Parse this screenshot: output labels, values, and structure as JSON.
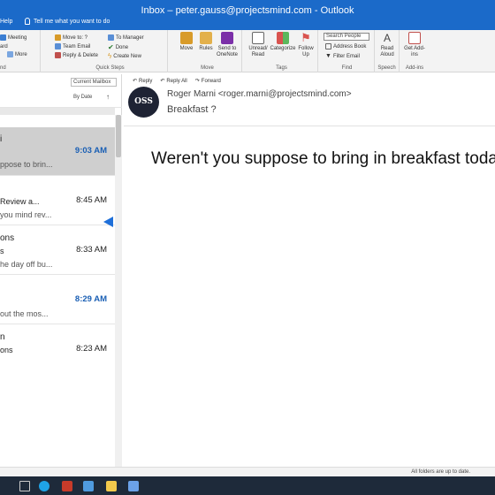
{
  "window": {
    "title": "Inbox – peter.gauss@projectsmind.com - Outlook",
    "help": "Help",
    "tell_me": "Tell me what you want to do"
  },
  "ribbon": {
    "new_group_label": "nd",
    "respond": {
      "meeting": "Meeting",
      "forward_partial": "ard",
      "more": "More"
    },
    "quick_steps": {
      "label": "Quick Steps",
      "items": [
        "Move to: ?",
        "To Manager",
        "Team Email",
        "Done",
        "Reply & Delete",
        "Create New"
      ]
    },
    "move": {
      "label": "Move",
      "move": "Move",
      "rules": "Rules",
      "onenote": "Send to OneNote"
    },
    "tags": {
      "label": "Tags",
      "unread_read": "Unread/ Read",
      "categorize": "Categorize",
      "follow_up": "Follow Up"
    },
    "find": {
      "label": "Find",
      "search_people": "Search People",
      "address_book": "Address Book",
      "filter_email": "Filter Email"
    },
    "speech": {
      "label": "Speech",
      "read_aloud": "Read Aloud"
    },
    "addins": {
      "label": "Add-ins",
      "get_addins": "Get Add-ins"
    },
    "colors": {
      "titlebar": "#1b6ac9",
      "accent": "#1a5fb4"
    }
  },
  "message_list": {
    "mailbox": "Current Mailbox",
    "sort": "By Date",
    "sort_arrow": "↑",
    "messages": [
      {
        "sender": "i",
        "subject": "",
        "preview": "ppose to brin...",
        "time": "9:03 AM",
        "unread": true,
        "selected": true
      },
      {
        "sender": "",
        "subject": "Review a...",
        "preview": "you mind rev...",
        "time": "8:45 AM",
        "unread": false,
        "selected": false
      },
      {
        "sender": "ons",
        "subject": "s",
        "preview": "he day off bu...",
        "time": "8:33 AM",
        "unread": false,
        "selected": false
      },
      {
        "sender": "",
        "subject": "",
        "preview": "out the mos...",
        "time": "8:29 AM",
        "unread": true,
        "selected": false
      },
      {
        "sender": "n",
        "subject": "ons",
        "preview": "",
        "time": "8:23 AM",
        "unread": false,
        "selected": false
      }
    ]
  },
  "reading_pane": {
    "actions": [
      "Reply",
      "Reply All",
      "Forward"
    ],
    "avatar": "OSS",
    "from": "Roger Marni <roger.marni@projectsmind.com>",
    "subject": "Breakfast ?",
    "body": "Weren't you suppose to bring in breakfast toda"
  },
  "status": {
    "text": "All folders are up to date."
  }
}
